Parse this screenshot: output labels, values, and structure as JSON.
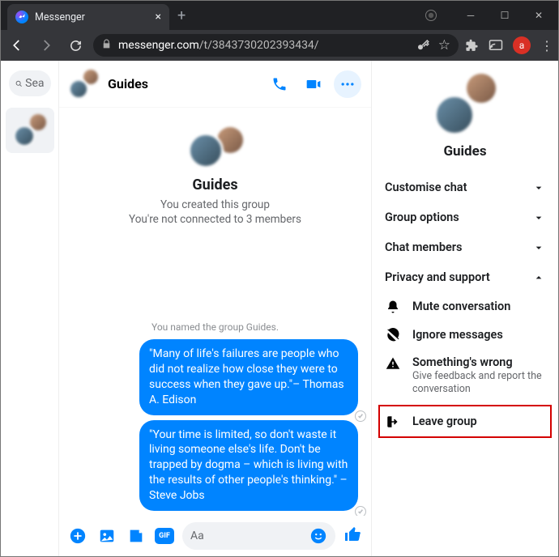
{
  "browser": {
    "tab_title": "Messenger",
    "url_domain": "messenger.com",
    "url_path": "/t/3843730202393434/",
    "profile_letter": "a"
  },
  "sidebar": {
    "search_label": "Sea"
  },
  "chat": {
    "title": "Guides",
    "big_name": "Guides",
    "created_line": "You created this group",
    "connected_line": "You're not connected to 3 members",
    "system_msg": "You named the group Guides.",
    "messages": [
      "\"Many of life's failures are people who did not realize how close they were to success when they gave up.\"– Thomas A. Edison",
      "\"Your time is limited, so don't waste it living someone else's life. Don't be trapped by dogma – which is living with the results of other people's thinking.\" – Steve Jobs"
    ],
    "input_placeholder": "Aa",
    "gif_label": "GIF"
  },
  "panel": {
    "name": "Guides",
    "sections": {
      "customise": "Customise chat",
      "group_options": "Group options",
      "chat_members": "Chat members",
      "privacy": "Privacy and support"
    },
    "actions": {
      "mute": "Mute conversation",
      "ignore": "Ignore messages",
      "wrong_title": "Something's wrong",
      "wrong_sub": "Give feedback and report the conversation",
      "leave": "Leave group"
    }
  }
}
